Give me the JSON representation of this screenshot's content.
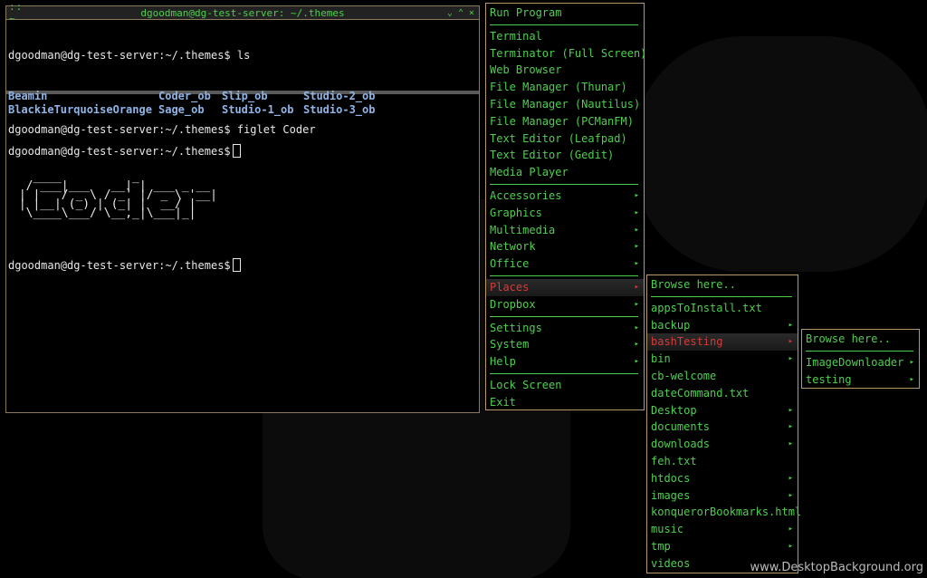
{
  "terminal": {
    "menu_glyph": "::  ~",
    "title": "dgoodman@dg-test-server: ~/.themes",
    "btn_minimize": "⌄",
    "btn_maximize": "⌃",
    "btn_close": "×",
    "top_pane": {
      "prompt1": "dgoodman@dg-test-server:~/.themes$ ls",
      "ls_items": [
        "Beamin",
        "Coder_ob",
        "Slip_ob",
        "Studio-2_ob",
        "BlackieTurquoiseOrange",
        "Sage_ob",
        "Studio-1_ob",
        "Studio-3_ob"
      ],
      "prompt2": "dgoodman@dg-test-server:~/.themes$"
    },
    "bottom_pane": {
      "prompt1": "dgoodman@dg-test-server:~/.themes$ figlet Coder",
      "figlet": "   ____          _\n  / ___|___   __| | ___ _ __\n | |   / _ \\ / _` |/ _ \\ '__|\n | |__| (_) | (_| |  __/ |\n  \\____\\___/ \\__,_|\\___|_|",
      "prompt2": "dgoodman@dg-test-server:~/.themes$"
    }
  },
  "root_menu": {
    "header": "Run Program",
    "apps": [
      "Terminal",
      "Terminator (Full Screen)",
      "Web Browser",
      "File Manager (Thunar)",
      "File Manager (Nautilus)",
      "File Manager (PCManFM)",
      "Text Editor (Leafpad)",
      "Text Editor (Gedit)",
      "Media Player"
    ],
    "categories": [
      "Accessories",
      "Graphics",
      "Multimedia",
      "Network",
      "Office"
    ],
    "places": [
      "Places",
      "Dropbox"
    ],
    "system": [
      "Settings",
      "System",
      "Help"
    ],
    "session": [
      "Lock Screen",
      "Exit"
    ]
  },
  "places_menu": {
    "header": "Browse here..",
    "items": [
      "appsToInstall.txt",
      "backup",
      "bashTesting",
      "bin",
      "cb-welcome",
      "dateCommand.txt",
      "Desktop",
      "documents",
      "downloads",
      "feh.txt",
      "htdocs",
      "images",
      "konquerorBookmarks.html",
      "music",
      "tmp",
      "videos"
    ]
  },
  "bash_menu": {
    "header": "Browse here..",
    "items": [
      "ImageDownloader",
      "testing"
    ]
  },
  "watermark": "www.DesktopBackground.org",
  "colors": {
    "menu_text": "#4ecf4e",
    "active_text": "#d83a3a",
    "ls_dir": "#8fb4e6",
    "border": "#b89868"
  }
}
